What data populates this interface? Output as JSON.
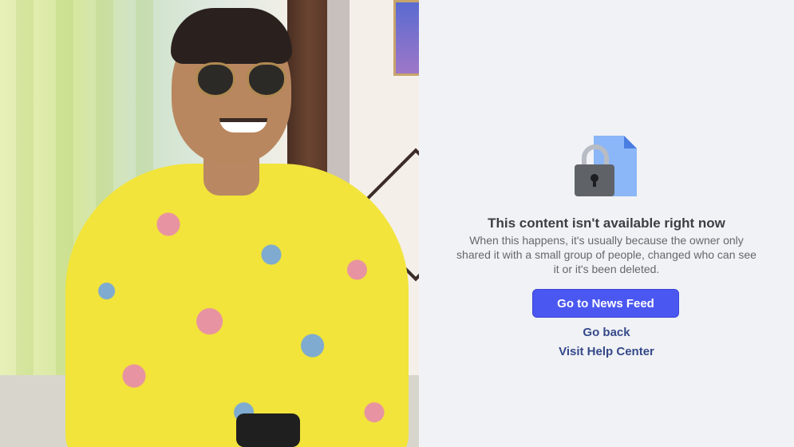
{
  "error_panel": {
    "title": "This content isn't available right now",
    "description": "When this happens, it's usually because the owner only shared it with a small group of people, changed who can see it or it's been deleted.",
    "primary_button": "Go to News Feed",
    "go_back_link": "Go back",
    "help_link": "Visit Help Center",
    "lock_icon": "lock-document-icon",
    "colors": {
      "panel_background": "#f0f2f5",
      "button_background": "#4a57f0",
      "link_color": "#36498a"
    }
  },
  "photo": {
    "icon": "person-photo"
  }
}
